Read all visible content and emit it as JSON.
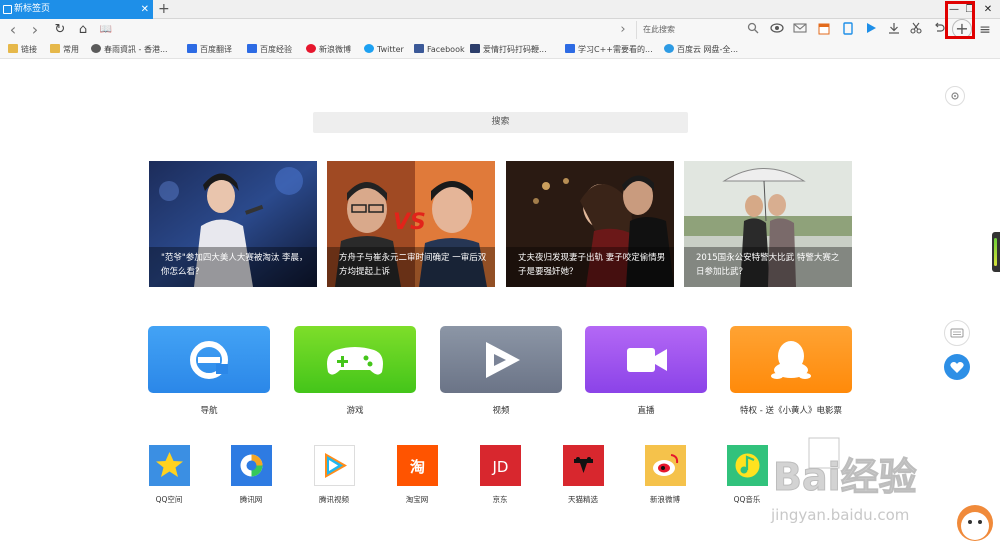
{
  "tab": {
    "title": "新标签页",
    "close": "✕"
  },
  "tabstrip": {
    "new_tab": "+",
    "minimize": "—",
    "restore": "❐",
    "close": "✕"
  },
  "toolbar": {
    "back": "‹",
    "forward": "›",
    "reload": "↻",
    "home": "⌂",
    "reader": "📖",
    "star": "★",
    "go": "›",
    "search_placeholder": "在此搜索",
    "add": "+",
    "menu": "≡"
  },
  "bookmarks": [
    {
      "label": "链接",
      "icon": "folder-icon",
      "color": "#e6b84a"
    },
    {
      "label": "常用",
      "icon": "folder-icon",
      "color": "#e6b84a"
    },
    {
      "label": "春雨資訊 - 香港...",
      "icon": "site-icon",
      "color": "#5b5b5b"
    },
    {
      "label": "百度翻译",
      "icon": "baidu-icon",
      "color": "#2d6be4"
    },
    {
      "label": "百度经验",
      "icon": "baidu-icon",
      "color": "#2d6be4"
    },
    {
      "label": "新浪微博",
      "icon": "weibo-icon",
      "color": "#e6162d"
    },
    {
      "label": "Twitter",
      "icon": "twitter-icon",
      "color": "#1da1f2"
    },
    {
      "label": "Facebook",
      "icon": "facebook-icon",
      "color": "#3b5998"
    },
    {
      "label": "爱情打码打码鞭...",
      "icon": "site-icon",
      "color": "#2d3e6b"
    },
    {
      "label": "学习C++需要看的...",
      "icon": "site-icon",
      "color": "#2d6be4"
    },
    {
      "label": "百度云 网盘-全...",
      "icon": "cloud-icon",
      "color": "#2d9be4"
    }
  ],
  "search": {
    "placeholder": "搜索"
  },
  "news": [
    {
      "caption": "\"范爷\"参加四大美人大赛被淘汰 李晨，你怎么看？"
    },
    {
      "caption": "方舟子与崔永元二审时间确定 一审后双方均提起上诉"
    },
    {
      "caption": "丈夫夜归发现妻子出轨 妻子咬定偷情男子是要强奸她？"
    },
    {
      "caption": "2015国永公安特警大比武 特警大赛之日参加比武？"
    }
  ],
  "apps": [
    {
      "label": "导航",
      "icon": "navigation-icon",
      "color_top": "#43a3f5",
      "color_bottom": "#2b87e8"
    },
    {
      "label": "游戏",
      "icon": "gamepad-icon",
      "color_top": "#7ede2a",
      "color_bottom": "#44c51a"
    },
    {
      "label": "视频",
      "icon": "play-icon",
      "color_top": "#8c96a6",
      "color_bottom": "#6b7487"
    },
    {
      "label": "直播",
      "icon": "camera-icon",
      "color_top": "#b468f5",
      "color_bottom": "#8b43e8"
    },
    {
      "label": "特权 - 送《小黄人》电影票",
      "icon": "qq-penguin-icon",
      "color_top": "#ffa333",
      "color_bottom": "#ff8a0a"
    }
  ],
  "sites": [
    {
      "label": "QQ空间",
      "icon": "qzone-icon",
      "bg": "#3b8fe3",
      "glyph": "★"
    },
    {
      "label": "腾讯网",
      "icon": "tencent-icon",
      "bg": "#2e7be2",
      "glyph": "◔"
    },
    {
      "label": "腾讯视频",
      "icon": "tencent-video-icon",
      "bg": "#ffffff",
      "glyph": "▶"
    },
    {
      "label": "淘宝网",
      "icon": "taobao-icon",
      "bg": "#ff5400",
      "glyph": "淘"
    },
    {
      "label": "京东",
      "icon": "jd-icon",
      "bg": "#d8272e",
      "glyph": "JD"
    },
    {
      "label": "天猫精选",
      "icon": "tmall-icon",
      "bg": "#d8272e",
      "glyph": "▼"
    },
    {
      "label": "新浪微博",
      "icon": "weibo-icon",
      "bg": "#f5c24b",
      "glyph": "◉"
    },
    {
      "label": "QQ音乐",
      "icon": "qq-music-icon",
      "bg": "#31c27c",
      "glyph": "♪"
    }
  ],
  "watermark": {
    "brand": "Bai经验",
    "url": "jingyan.baidu.com"
  }
}
